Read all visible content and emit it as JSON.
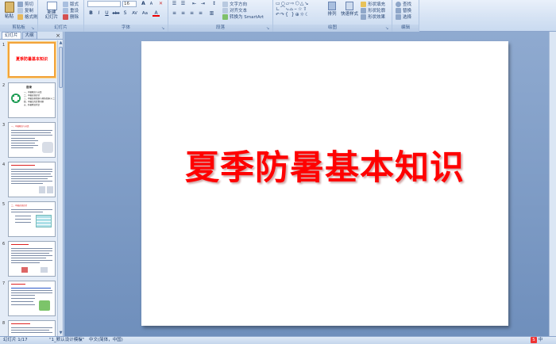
{
  "ribbon": {
    "clipboard": {
      "label": "剪贴板",
      "paste": "粘贴",
      "cut": "剪切",
      "copy": "复制",
      "format_painter": "格式刷"
    },
    "slides": {
      "label": "幻灯片",
      "new_slide": "新建\n幻灯片",
      "layout": "版式",
      "reset": "重设",
      "delete": "删除"
    },
    "font": {
      "label": "字体",
      "font_size": "16",
      "bold": "B",
      "italic": "I",
      "underline": "U",
      "strike": "abc",
      "shadow": "S",
      "spacing": "AV",
      "case": "Aa",
      "color": "A",
      "grow": "A",
      "shrink": "A"
    },
    "paragraph": {
      "label": "段落",
      "text_direction": "文字方向",
      "align_text": "对齐文本",
      "convert_smartart": "转换为 SmartArt"
    },
    "drawing": {
      "label": "绘图",
      "arrange": "排列",
      "quick_styles": "快速样式",
      "shape_fill": "形状填充",
      "shape_outline": "形状轮廓",
      "shape_effects": "形状效果"
    },
    "editing": {
      "label": "编辑",
      "find": "查找",
      "replace": "替换",
      "select": "选择"
    }
  },
  "panel": {
    "tabs": [
      "幻灯片",
      "大纲"
    ],
    "active_tab": "幻灯片",
    "close": "×",
    "thumbnails": [
      {
        "num": "1",
        "title": "夏季防暑基本知识"
      },
      {
        "num": "2",
        "title": "目录",
        "items": [
          "一、中暑概念与分类",
          "二、中暑表现症状",
          "三、中暑急救措施与预防措施(十二)",
          "四、中暑后的饮食问题",
          "五、防暑降温常识"
        ]
      },
      {
        "num": "3",
        "title": "一、中暑概念与分类"
      },
      {
        "num": "4",
        "title": ""
      },
      {
        "num": "5",
        "title": "二、中暑表现症状"
      },
      {
        "num": "6",
        "title": ""
      },
      {
        "num": "7",
        "title": ""
      },
      {
        "num": "8",
        "title": ""
      }
    ]
  },
  "slide": {
    "title": "夏季防暑基本知识"
  },
  "status": {
    "slide_count": "幻灯片 1/17",
    "theme": "\"1_默认设计模板\"",
    "language": "中文(简体，中国)",
    "ime": "中"
  },
  "colors": {
    "title_red": "#ff0000",
    "ribbon_bg": "#d6e3f4",
    "selection_orange": "#f2a33a"
  }
}
